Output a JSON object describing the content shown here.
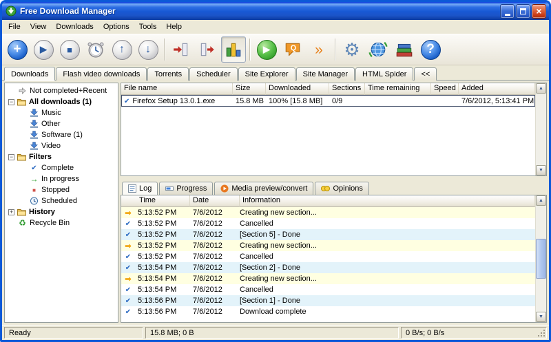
{
  "window": {
    "title": "Free Download Manager"
  },
  "colors": {
    "titlebar_blue": "#1859D4",
    "face": "#ECE9D8",
    "selection": "#316AC5",
    "log_row_yellow": "#FFFFE1",
    "log_row_cyan": "#E3F3FA",
    "check_blue": "#2565C0",
    "arrow_orange": "#F0A000"
  },
  "titlebar_buttons": {
    "minimize": "minimize-icon",
    "maximize": "maximize-icon",
    "close_glyph": "×"
  },
  "menu": {
    "items": [
      "File",
      "View",
      "Downloads",
      "Options",
      "Tools",
      "Help"
    ]
  },
  "toolbar": {
    "buttons": [
      {
        "name": "add-download-button",
        "icon": "plus-icon",
        "glyph": "+"
      },
      {
        "name": "start-download-button",
        "icon": "play-icon",
        "glyph": "▶"
      },
      {
        "name": "stop-download-button",
        "icon": "stop-icon",
        "glyph": "■"
      },
      {
        "name": "scheduler-button",
        "icon": "alarm-clock-icon",
        "glyph": ""
      },
      {
        "name": "move-up-button",
        "icon": "up-arrow-icon",
        "glyph": "↑"
      },
      {
        "name": "move-down-button",
        "icon": "down-arrow-icon",
        "glyph": "↓"
      },
      {
        "name": "import-list-button",
        "icon": "import-arrow-icon",
        "glyph": ""
      },
      {
        "name": "export-list-button",
        "icon": "export-arrow-icon",
        "glyph": ""
      },
      {
        "name": "sections-chart-toggle",
        "icon": "bars-chart-icon",
        "glyph": "",
        "pressed": true
      },
      {
        "name": "start-all-button",
        "icon": "green-play-icon",
        "glyph": "▶"
      },
      {
        "name": "feedback-button",
        "icon": "chat-bubble-icon",
        "glyph": "Q"
      },
      {
        "name": "community-button",
        "icon": "double-chevron-icon",
        "glyph": "»"
      },
      {
        "name": "settings-button",
        "icon": "gear-icon",
        "glyph": "⚙"
      },
      {
        "name": "remote-control-button",
        "icon": "globe-icon",
        "glyph": ""
      },
      {
        "name": "library-button",
        "icon": "books-icon",
        "glyph": ""
      },
      {
        "name": "help-button",
        "icon": "question-icon",
        "glyph": "?"
      }
    ]
  },
  "tabs": {
    "active": "Downloads",
    "items": [
      "Downloads",
      "Flash video downloads",
      "Torrents",
      "Scheduler",
      "Site Explorer",
      "Site Manager",
      "HTML Spider",
      "<<"
    ]
  },
  "sidebar": {
    "items": [
      {
        "label": "Not completed+Recent",
        "icon": "gray-arrow-icon"
      },
      {
        "label": "All downloads (1)",
        "icon": "folder-icon",
        "bold": true,
        "expanded": true
      },
      {
        "label": "Music",
        "icon": "category-icon"
      },
      {
        "label": "Other",
        "icon": "category-icon"
      },
      {
        "label": "Software (1)",
        "icon": "category-icon"
      },
      {
        "label": "Video",
        "icon": "category-icon"
      },
      {
        "label": "Filters",
        "icon": "folder-icon",
        "bold": true,
        "expanded": true
      },
      {
        "label": "Complete",
        "icon": "check-icon"
      },
      {
        "label": "In progress",
        "icon": "green-arrow-icon"
      },
      {
        "label": "Stopped",
        "icon": "red-square-icon"
      },
      {
        "label": "Scheduled",
        "icon": "clock-icon"
      },
      {
        "label": "History",
        "icon": "folder-icon",
        "bold": true,
        "expanded": false
      },
      {
        "label": "Recycle Bin",
        "icon": "recycle-icon"
      }
    ]
  },
  "downloads": {
    "columns": [
      "File name",
      "Size",
      "Downloaded",
      "Sections",
      "Time remaining",
      "Speed",
      "Added"
    ],
    "rows": [
      {
        "name": "Firefox Setup 13.0.1.exe",
        "size": "15.8 MB",
        "downloaded": "100% [15.8 MB]",
        "sections": "0/9",
        "time_remaining": "",
        "speed": "",
        "added": "7/6/2012, 5:13:41 PM",
        "icon": "check-icon",
        "selected": true
      }
    ]
  },
  "bottom_tabs": {
    "active": "Log",
    "items": [
      "Log",
      "Progress",
      "Media preview/convert",
      "Opinions"
    ]
  },
  "log": {
    "columns": [
      "Time",
      "Date",
      "Information"
    ],
    "rows": [
      {
        "time": "5:13:52 PM",
        "date": "7/6/2012",
        "info": "Creating new section...",
        "icon": "arrow",
        "tone": "yellow"
      },
      {
        "time": "5:13:52 PM",
        "date": "7/6/2012",
        "info": "Cancelled",
        "icon": "check",
        "tone": "white"
      },
      {
        "time": "5:13:52 PM",
        "date": "7/6/2012",
        "info": "[Section 5] - Done",
        "icon": "check",
        "tone": "cyan"
      },
      {
        "time": "5:13:52 PM",
        "date": "7/6/2012",
        "info": "Creating new section...",
        "icon": "arrow",
        "tone": "yellow"
      },
      {
        "time": "5:13:52 PM",
        "date": "7/6/2012",
        "info": "Cancelled",
        "icon": "check",
        "tone": "white"
      },
      {
        "time": "5:13:54 PM",
        "date": "7/6/2012",
        "info": "[Section 2] - Done",
        "icon": "check",
        "tone": "cyan"
      },
      {
        "time": "5:13:54 PM",
        "date": "7/6/2012",
        "info": "Creating new section...",
        "icon": "arrow",
        "tone": "yellow"
      },
      {
        "time": "5:13:54 PM",
        "date": "7/6/2012",
        "info": "Cancelled",
        "icon": "check",
        "tone": "white"
      },
      {
        "time": "5:13:56 PM",
        "date": "7/6/2012",
        "info": "[Section 1] - Done",
        "icon": "check",
        "tone": "cyan"
      },
      {
        "time": "5:13:56 PM",
        "date": "7/6/2012",
        "info": "Download complete",
        "icon": "check",
        "tone": "white"
      }
    ]
  },
  "status": {
    "left": "Ready",
    "center": "15.8 MB; 0 B",
    "right": "0 B/s; 0 B/s"
  }
}
